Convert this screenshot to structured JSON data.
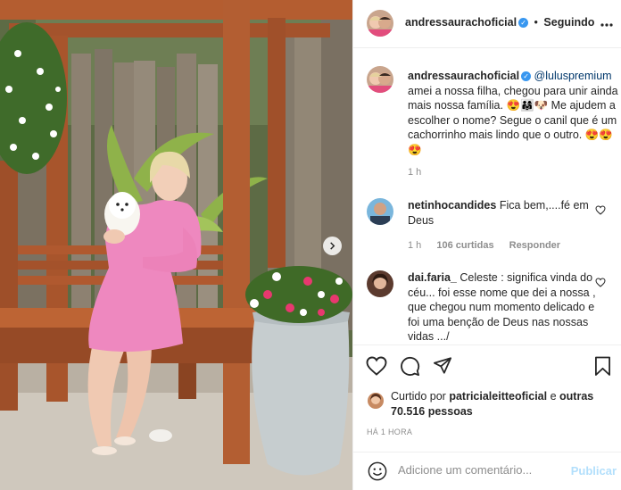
{
  "colors": {
    "accent": "#0095f6",
    "verified": "#3897f0",
    "publish_disabled": "#b2dffc",
    "border": "#efefef"
  },
  "header": {
    "username": "andressaurachoficial",
    "separator": "•",
    "follow_status": "Seguindo",
    "more_icon": "ellipsis-icon"
  },
  "caption": {
    "username": "andressaurachoficial",
    "mention": "@luluspremium",
    "text": "amei a nossa filha, chegou para unir ainda mais nossa família. 😍👨‍👩‍👧🐶 Me ajudem a escolher o nome? Segue o canil que é um cachorrinho mais lindo que o outro. 😍😍😍",
    "time": "1 h"
  },
  "comments": [
    {
      "username": "netinhocandides",
      "text": "Fica bem,....fé em Deus",
      "time": "1 h",
      "likes": "106 curtidas",
      "reply": "Responder"
    },
    {
      "username": "dai.faria_",
      "text": "Celeste : significa vinda do céu... foi esse nome que dei a nossa , que chegou num momento delicado e foi uma benção de Deus nas nossas vidas .../"
    }
  ],
  "actions": {
    "like": "heart-icon",
    "comment": "comment-icon",
    "share": "send-icon",
    "save": "bookmark-icon"
  },
  "likes": {
    "prefix": "Curtido por",
    "user": "patricialeitteoficial",
    "connector": "e",
    "others": "outras 70.516 pessoas"
  },
  "post_time": "HÁ 1 HORA",
  "comment_box": {
    "placeholder": "Adicione um comentário...",
    "publish": "Publicar",
    "emoji_icon": "smiley-icon"
  }
}
